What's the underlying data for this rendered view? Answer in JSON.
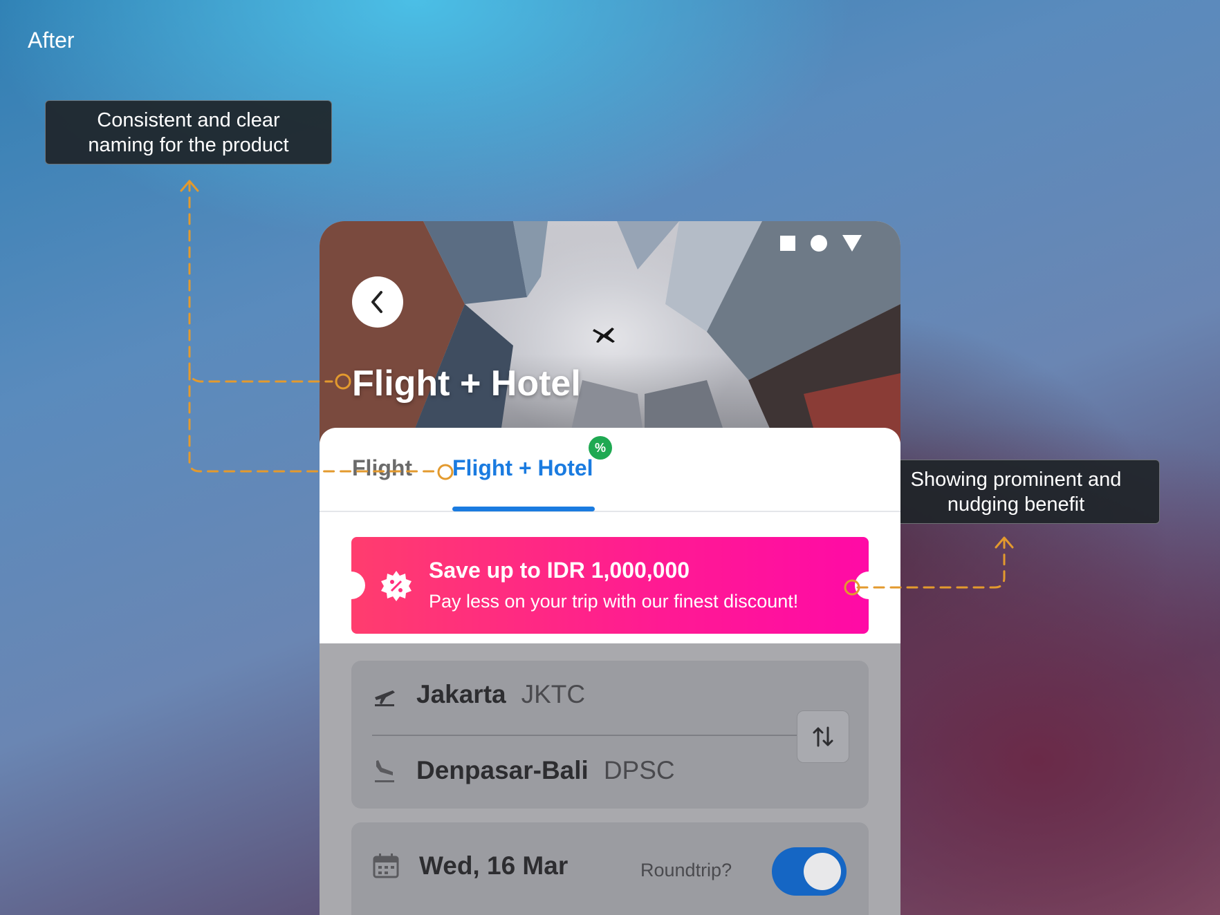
{
  "page": {
    "label": "After"
  },
  "callouts": {
    "naming": {
      "line1": "Consistent and clear",
      "line2": "naming for the product"
    },
    "benefit": {
      "line1": "Showing prominent and",
      "line2": "nudging benefit"
    }
  },
  "colors": {
    "accent": "#1a7be0",
    "promo_start": "#ff3d6e",
    "promo_end": "#ff0aa6",
    "annotation_line": "#e39a2e",
    "badge_green": "#1fa952",
    "toggle_on": "#1566c4"
  },
  "hero": {
    "title": "Flight + Hotel"
  },
  "tabs": [
    {
      "label": "Flight",
      "active": false
    },
    {
      "label": "Flight + Hotel",
      "active": true
    }
  ],
  "promo": {
    "title": "Save up to IDR 1,000,000",
    "subtitle": "Pay less on your trip with our finest discount!"
  },
  "route": {
    "origin": {
      "city": "Jakarta",
      "code": "JKTC"
    },
    "destination": {
      "city": "Denpasar-Bali",
      "code": "DPSC"
    }
  },
  "date": {
    "value": "Wed, 16 Mar",
    "roundtrip_label": "Roundtrip?",
    "roundtrip_on": true
  },
  "icons": [
    "chevron-left-icon",
    "airplane-icon",
    "takeoff-icon",
    "landing-icon",
    "swap-icon",
    "calendar-icon",
    "discount-icon"
  ]
}
